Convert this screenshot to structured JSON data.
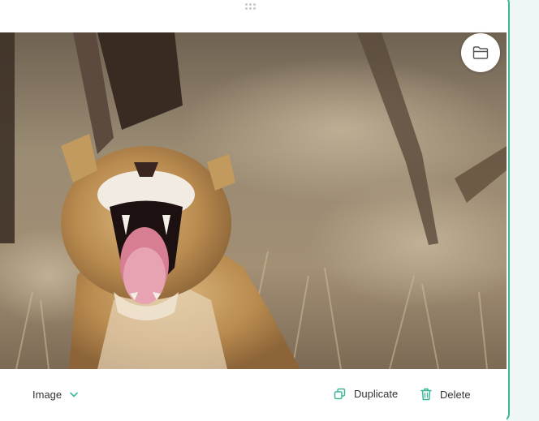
{
  "image_block": {
    "image_alt": "Lioness yawning with mouth wide open in dry grass",
    "folder_button_icon": "folder-icon",
    "drag_handle_icon": "drag-dots-icon"
  },
  "footer": {
    "type_select": {
      "value": "Image",
      "icon": "chevron-down-icon"
    },
    "duplicate": {
      "label": "Duplicate",
      "icon": "duplicate-icon"
    },
    "delete": {
      "label": "Delete",
      "icon": "trash-icon"
    }
  },
  "colors": {
    "accent": "#3fb59a",
    "gutter": "#eef7f5",
    "text": "#333333"
  }
}
